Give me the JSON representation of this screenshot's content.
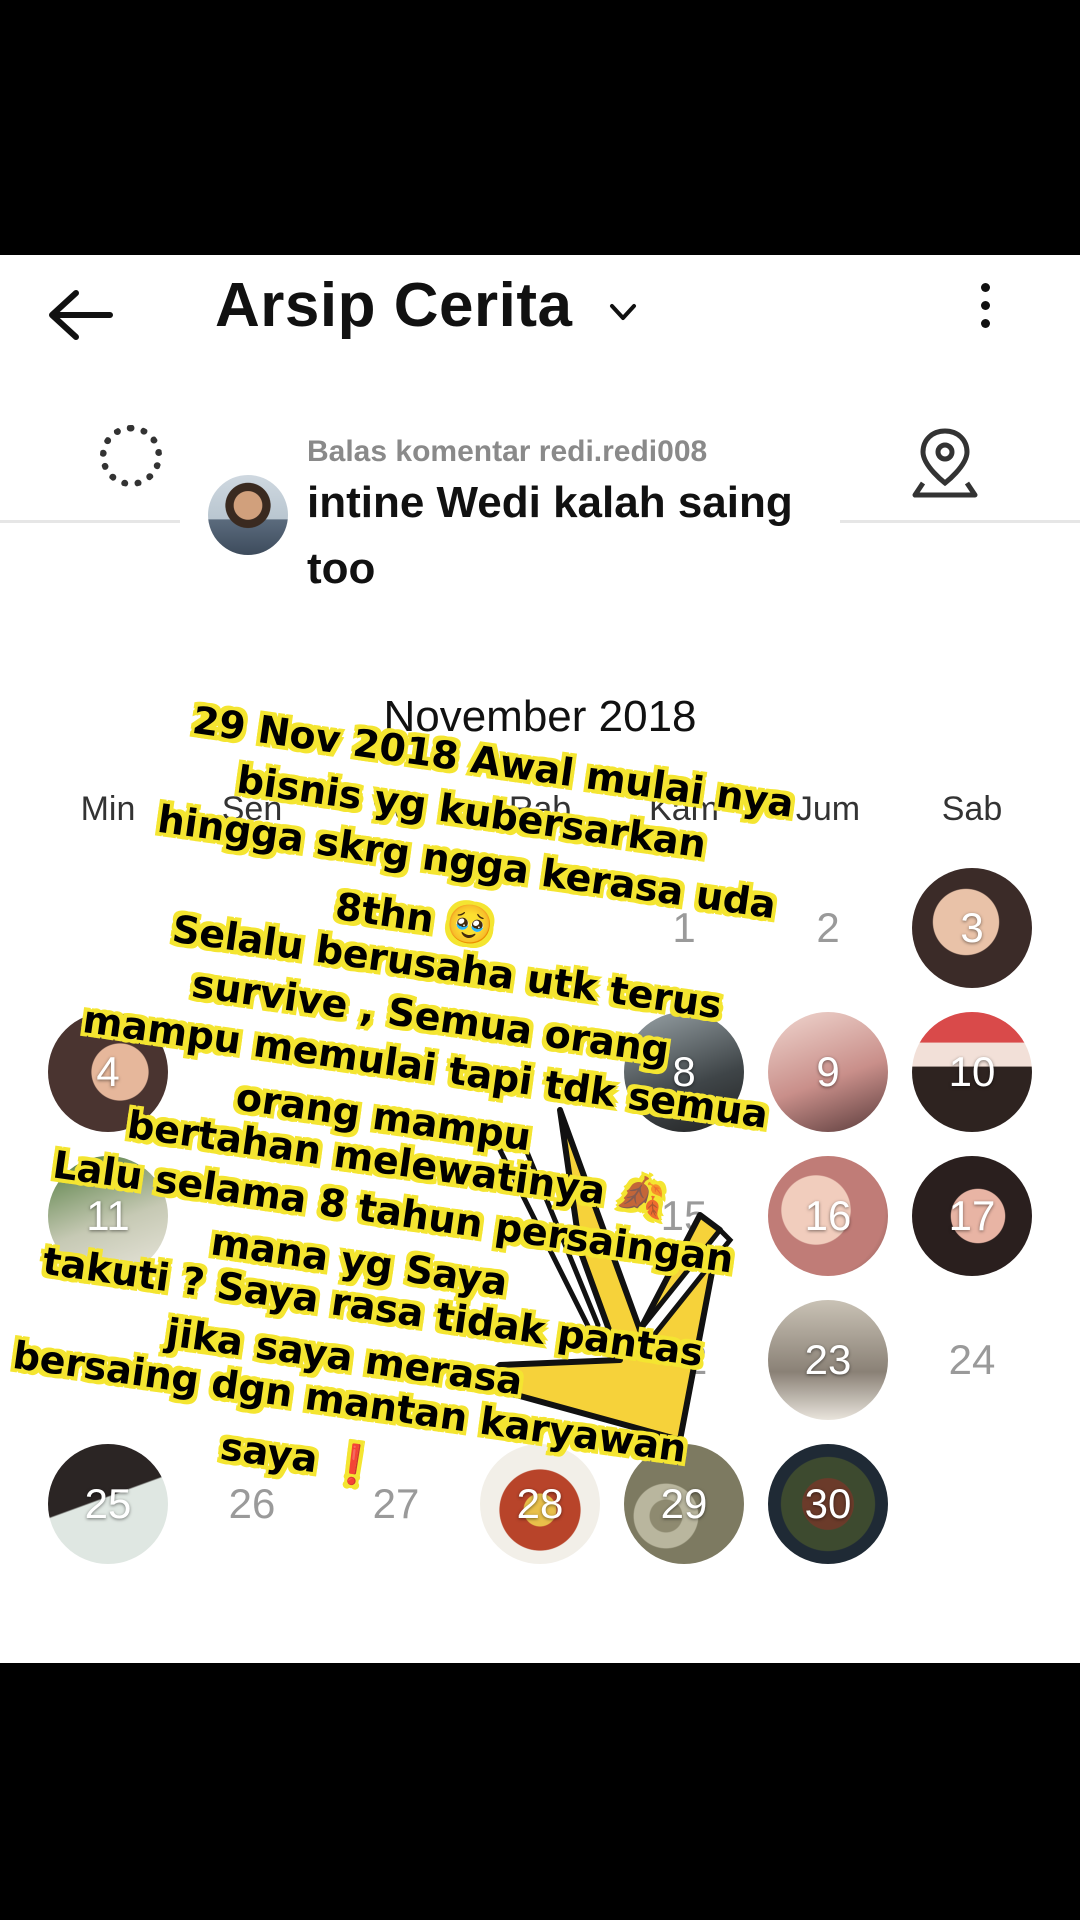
{
  "header": {
    "title": "Arsip Cerita",
    "back_icon": "arrow-left-icon",
    "dropdown_icon": "chevron-down-icon",
    "more_icon": "more-vertical-icon"
  },
  "filter": {
    "left_icon": "loading-dots-icon",
    "right_icon": "map-pin-icon"
  },
  "reply_sticker": {
    "label": "Balas komentar redi.redi008",
    "text": "intine Wedi kalah saing too"
  },
  "calendar": {
    "month": "November 2018",
    "weekdays": [
      "Min",
      "Sen",
      "Sel",
      "Rab",
      "Kam",
      "Jum",
      "Sab"
    ],
    "days": {
      "d1": "1",
      "d2": "2",
      "d3": "3",
      "d4": "4",
      "d8": "8",
      "d9": "9",
      "d10": "10",
      "d11": "11",
      "d15": "15",
      "d16": "16",
      "d17": "17",
      "d22": "22",
      "d23": "23",
      "d24": "24",
      "d25": "25",
      "d26": "26",
      "d27": "27",
      "d28": "28",
      "d29": "29",
      "d30": "30"
    }
  },
  "caption": {
    "l1": "29 Nov 2018 Awal mulai nya",
    "l2": "bisnis yg kubersarkan",
    "l3": "hingga skrg ngga kerasa uda",
    "l4": "8thn 🥹",
    "l5": "Selalu berusaha utk terus",
    "l6": "survive , Semua orang",
    "l7": "mampu memulai tapi tdk semua",
    "l8": "orang mampu",
    "l9": "bertahan melewatinya 🍂",
    "l10": "Lalu selama 8 tahun persaingan",
    "l11": "mana yg Saya",
    "l12": "takuti ? Saya rasa tidak pantas",
    "l13": "jika saya merasa",
    "l14": "bersaing dgn mantan karyawan",
    "l15": "saya ❗"
  },
  "colors": {
    "caption_fill": "#000000",
    "caption_outline": "#f4e531",
    "arrow": "#f6d23a"
  }
}
